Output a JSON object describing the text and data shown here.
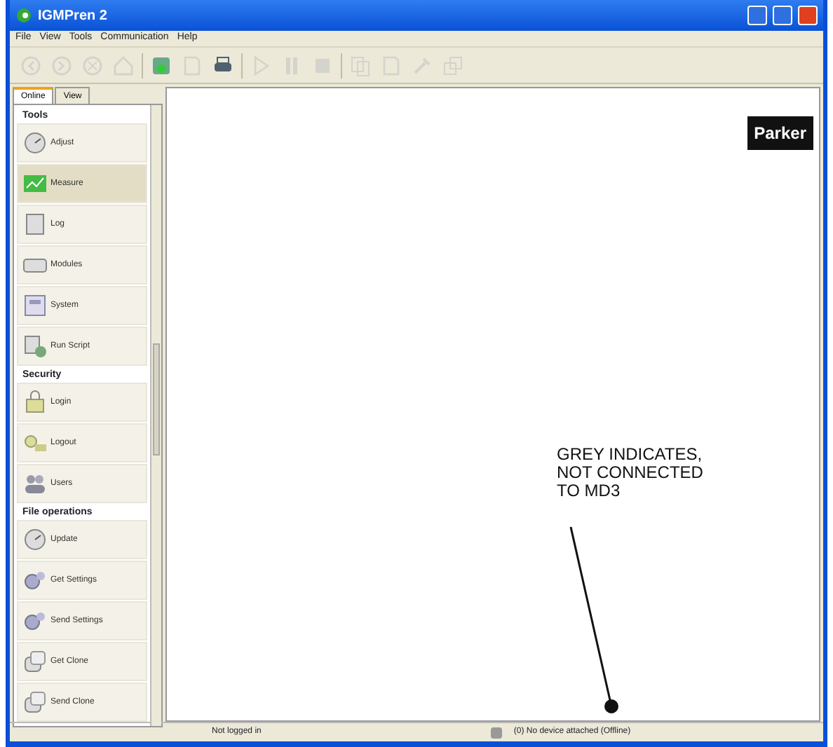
{
  "window": {
    "title": "IGMPren 2"
  },
  "menu": [
    "File",
    "View",
    "Tools",
    "Communication",
    "Help"
  ],
  "toolbar": [
    {
      "kind": "back",
      "disabled": true
    },
    {
      "kind": "forward",
      "disabled": true
    },
    {
      "kind": "stop-circle",
      "disabled": true
    },
    {
      "kind": "home",
      "disabled": true
    },
    {
      "kind": "connect",
      "disabled": false
    },
    {
      "kind": "page",
      "disabled": true
    },
    {
      "kind": "print",
      "disabled": false
    },
    {
      "kind": "play",
      "disabled": true
    },
    {
      "kind": "pause",
      "disabled": true
    },
    {
      "kind": "stop",
      "disabled": true
    },
    {
      "kind": "copy",
      "disabled": true
    },
    {
      "kind": "page",
      "disabled": true
    },
    {
      "kind": "tools",
      "disabled": true
    },
    {
      "kind": "windows",
      "disabled": true
    }
  ],
  "tabs": [
    {
      "label": "Online",
      "selected": true
    },
    {
      "label": "View",
      "selected": false
    }
  ],
  "sections": [
    {
      "title": "Tools",
      "items": [
        {
          "label": "Adjust",
          "kind": "gauge",
          "selected": false
        },
        {
          "label": "Measure",
          "kind": "chart",
          "selected": true
        },
        {
          "label": "Log",
          "kind": "doc",
          "selected": false
        },
        {
          "label": "Modules",
          "kind": "module",
          "selected": false
        },
        {
          "label": "System",
          "kind": "system",
          "selected": false
        },
        {
          "label": "Run Script",
          "kind": "script",
          "selected": false
        }
      ]
    },
    {
      "title": "Security",
      "items": [
        {
          "label": "Login",
          "kind": "lock",
          "selected": false
        },
        {
          "label": "Logout",
          "kind": "key",
          "selected": false
        },
        {
          "label": "Users",
          "kind": "users",
          "selected": false
        }
      ]
    },
    {
      "title": "File operations",
      "items": [
        {
          "label": "Update",
          "kind": "gauge",
          "selected": false
        },
        {
          "label": "Get Settings",
          "kind": "gears",
          "selected": false
        },
        {
          "label": "Send Settings",
          "kind": "gears",
          "selected": false
        },
        {
          "label": "Get Clone",
          "kind": "clone",
          "selected": false
        },
        {
          "label": "Send Clone",
          "kind": "clone",
          "selected": false
        }
      ]
    }
  ],
  "logo": "Parker",
  "annotation": "GREY INDICATES, NOT CONNECTED TO MD3",
  "status_bar": {
    "login": "Not logged in",
    "device": "(0) No device attached (Offline)",
    "connected": false
  }
}
